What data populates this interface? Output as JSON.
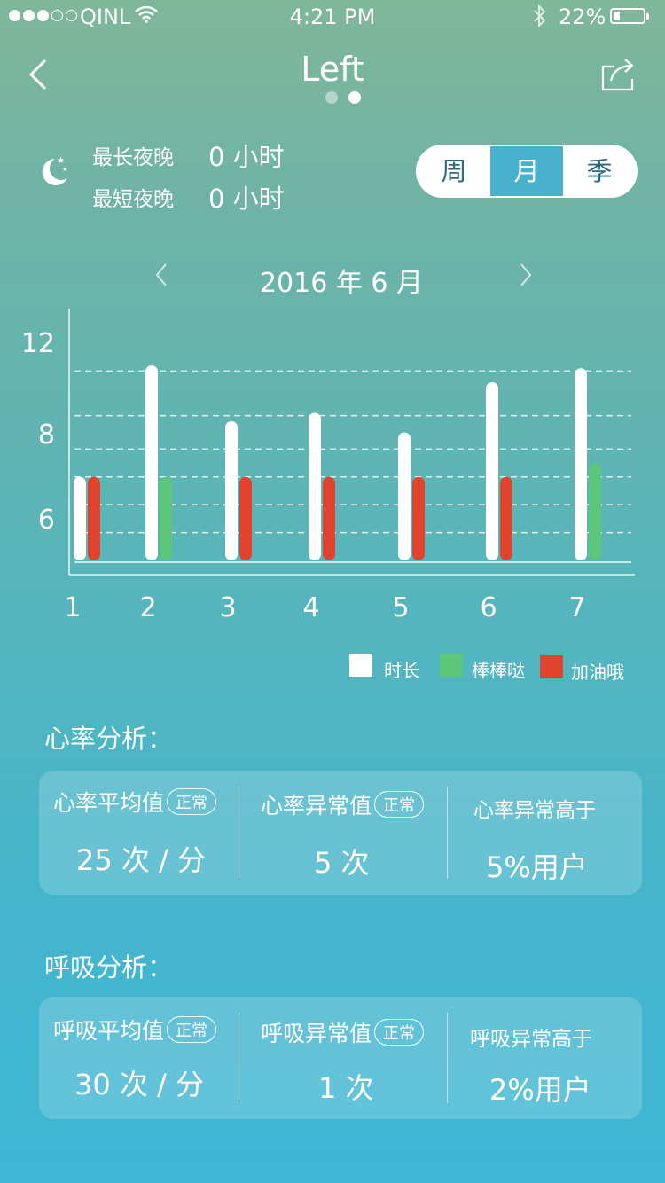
{
  "status_bar": {
    "carrier": "QINL",
    "time": "4:21 PM",
    "battery": "22%",
    "battery_level": 0.22
  },
  "nav": {
    "title": "Left",
    "page_count": 2,
    "active_page": 1
  },
  "sleep": {
    "longest_label": "最长夜晚",
    "longest_value": "0 小时",
    "shortest_label": "最短夜晚",
    "shortest_value": "0 小时"
  },
  "segment": {
    "options": [
      "周",
      "月",
      "季"
    ],
    "selected": "月"
  },
  "chart": {
    "month_label": "2016 年 6 月"
  },
  "chart_data": {
    "type": "bar",
    "categories": [
      "1",
      "2",
      "3",
      "4",
      "5",
      "6",
      "7"
    ],
    "yticks": [
      6,
      8,
      12
    ],
    "ylim": [
      5,
      12.8
    ],
    "grid": "dashed",
    "series": [
      {
        "name": "时长",
        "color": "#ffffff",
        "values": [
          8,
          12,
          10,
          10.3,
          9.6,
          11.4,
          11.9
        ]
      },
      {
        "name": "棒棒哒",
        "color": "#5cc67a",
        "values": [
          null,
          8,
          null,
          null,
          null,
          null,
          8.5
        ]
      },
      {
        "name": "加油哦",
        "color": "#e2432f",
        "values": [
          8,
          null,
          8,
          8,
          8,
          8,
          null
        ]
      }
    ],
    "legend": "bottom-right"
  },
  "heart": {
    "title": "心率分析：",
    "avg_label": "心率平均值",
    "avg_badge": "正常",
    "avg_value": "25 次 / 分",
    "abn_label": "心率异常值",
    "abn_badge": "正常",
    "abn_value": "5 次",
    "higher_label": "心率异常高于",
    "higher_value": "5%用户"
  },
  "breath": {
    "title": "呼吸分析：",
    "avg_label": "呼吸平均值",
    "avg_badge": "正常",
    "avg_value": "30 次 / 分",
    "abn_label": "呼吸异常值",
    "abn_badge": "正常",
    "abn_value": "1 次",
    "higher_label": "呼吸异常高于",
    "higher_value": "2%用户"
  },
  "icons": {
    "back": "chevron-left-icon",
    "share": "share-icon",
    "moon": "moon-icon",
    "wifi": "wifi-icon",
    "bluetooth": "bluetooth-icon"
  }
}
